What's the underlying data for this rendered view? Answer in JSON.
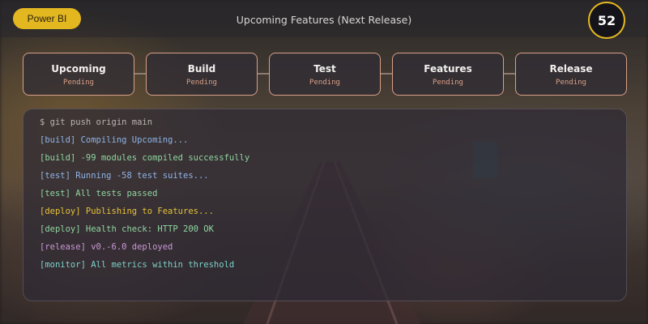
{
  "header": {
    "brand_label": "Power BI",
    "title": "Upcoming Features (Next Release)",
    "counter": "52"
  },
  "pipeline": {
    "stages": [
      {
        "name": "Upcoming",
        "status": "Pending"
      },
      {
        "name": "Build",
        "status": "Pending"
      },
      {
        "name": "Test",
        "status": "Pending"
      },
      {
        "name": "Features",
        "status": "Pending"
      },
      {
        "name": "Release",
        "status": "Pending"
      }
    ]
  },
  "console": {
    "lines": [
      {
        "text": "$ git push origin main",
        "color": "#b8b4b0"
      },
      {
        "text": "[build] Compiling Upcoming...",
        "color": "#8fb4e8"
      },
      {
        "text": "[build] -99 modules compiled successfully",
        "color": "#8fd6a0"
      },
      {
        "text": "[test] Running -58 test suites...",
        "color": "#8fb4e8"
      },
      {
        "text": "[test] All tests passed",
        "color": "#8fd6a0"
      },
      {
        "text": "[deploy] Publishing to Features...",
        "color": "#e6c23a"
      },
      {
        "text": "[deploy] Health check: HTTP 200 OK",
        "color": "#8fd6a0"
      },
      {
        "text": "[release] v0.-6.0 deployed",
        "color": "#c998d8"
      },
      {
        "text": "[monitor] All metrics within threshold",
        "color": "#7fd0c8"
      }
    ]
  },
  "colors": {
    "accent": "#e3b720",
    "stage_border": "#d8a088"
  }
}
